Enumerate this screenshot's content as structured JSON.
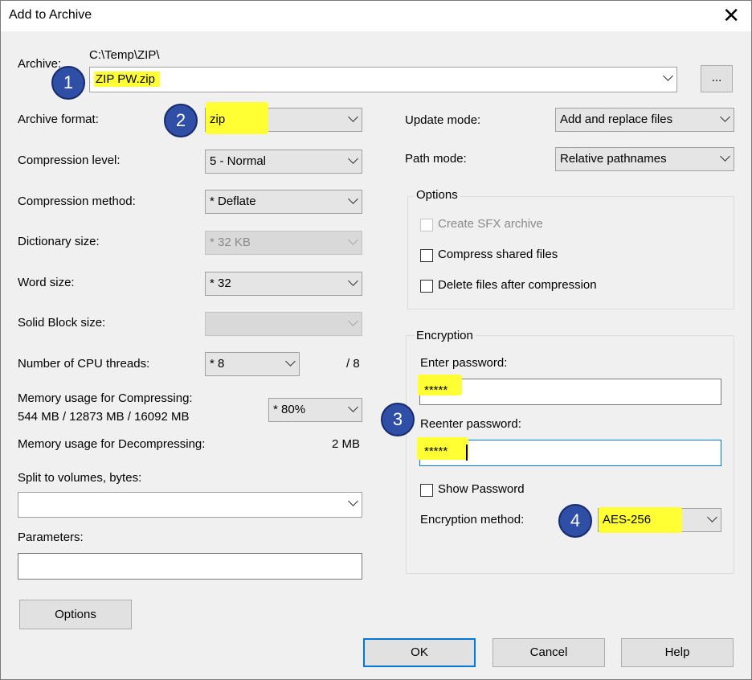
{
  "window": {
    "title": "Add to Archive"
  },
  "archive": {
    "label": "Archive:",
    "path": "C:\\Temp\\ZIP\\",
    "filename": "ZIP PW.zip",
    "browse_label": "..."
  },
  "left": {
    "archive_format": {
      "label": "Archive format:",
      "value": "zip"
    },
    "compression_level": {
      "label": "Compression level:",
      "value": "5 - Normal"
    },
    "compression_method": {
      "label": "Compression method:",
      "value": "*  Deflate"
    },
    "dictionary_size": {
      "label": "Dictionary size:",
      "value": "*  32 KB"
    },
    "word_size": {
      "label": "Word size:",
      "value": "*  32"
    },
    "solid_block": {
      "label": "Solid Block size:",
      "value": ""
    },
    "cpu_threads": {
      "label": "Number of CPU threads:",
      "value": "*  8",
      "max": "/ 8"
    },
    "memory_compress": {
      "label": "Memory usage for Compressing:",
      "detail": "544 MB / 12873 MB / 16092 MB",
      "value": "*  80%"
    },
    "memory_decompress": {
      "label": "Memory usage for Decompressing:",
      "value": "2 MB"
    },
    "split": {
      "label": "Split to volumes, bytes:",
      "value": ""
    },
    "parameters": {
      "label": "Parameters:",
      "value": ""
    },
    "options_button": "Options"
  },
  "right": {
    "update_mode": {
      "label": "Update mode:",
      "value": "Add and replace files"
    },
    "path_mode": {
      "label": "Path mode:",
      "value": "Relative pathnames"
    },
    "options_group": {
      "title": "Options",
      "sfx": "Create SFX archive",
      "shared": "Compress shared files",
      "delete_after": "Delete files after compression"
    },
    "encryption": {
      "title": "Encryption",
      "enter_label": "Enter password:",
      "enter_value": "*****",
      "reenter_label": "Reenter password:",
      "reenter_value": "*****",
      "show_password": "Show Password",
      "method_label": "Encryption method:",
      "method_value": "AES-256"
    }
  },
  "buttons": {
    "ok": "OK",
    "cancel": "Cancel",
    "help": "Help"
  },
  "markers": [
    "1",
    "2",
    "3",
    "4"
  ],
  "colors": {
    "highlight": "#ffff33",
    "marker": "#2f4ea5",
    "focus": "#0078d7"
  }
}
